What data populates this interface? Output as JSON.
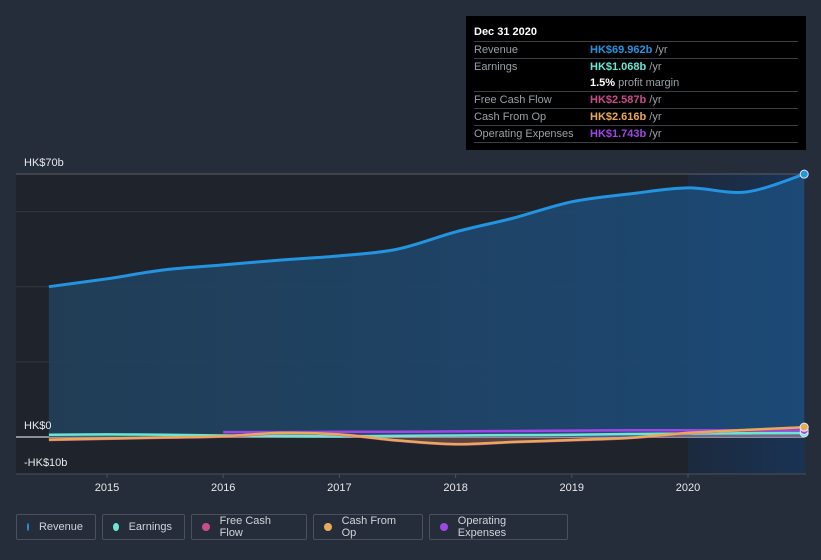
{
  "tooltip": {
    "date": "Dec 31 2020",
    "rows": [
      {
        "label": "Revenue",
        "value": "HK$69.962b",
        "unit": "/yr",
        "color": "#2394df"
      },
      {
        "label": "Earnings",
        "value": "HK$1.068b",
        "unit": "/yr",
        "color": "#6ce5d4"
      },
      {
        "label": "",
        "value": "1.5%",
        "unit": "profit margin",
        "color": "#ffffff"
      },
      {
        "label": "Free Cash Flow",
        "value": "HK$2.587b",
        "unit": "/yr",
        "color": "#c94c8c"
      },
      {
        "label": "Cash From Op",
        "value": "HK$2.616b",
        "unit": "/yr",
        "color": "#e9a95b"
      },
      {
        "label": "Operating Expenses",
        "value": "HK$1.743b",
        "unit": "/yr",
        "color": "#9d48e5"
      }
    ]
  },
  "legend": [
    {
      "label": "Revenue",
      "color": "#2394df"
    },
    {
      "label": "Earnings",
      "color": "#6ce5d4"
    },
    {
      "label": "Free Cash Flow",
      "color": "#c94c8c"
    },
    {
      "label": "Cash From Op",
      "color": "#e9a95b"
    },
    {
      "label": "Operating Expenses",
      "color": "#9d48e5"
    }
  ],
  "chart_data": {
    "type": "area",
    "title": "",
    "xlabel": "",
    "ylabel": "",
    "y_tick_labels": [
      "HK$70b",
      "HK$0",
      "-HK$10b"
    ],
    "y_ticks": [
      70,
      0,
      -10
    ],
    "gridlines": [
      0,
      20,
      40,
      60,
      70
    ],
    "ylim": [
      -10,
      70
    ],
    "xlim": [
      2014.5,
      2021.0
    ],
    "x_ticks": [
      2015,
      2016,
      2017,
      2018,
      2019,
      2020
    ],
    "x_tick_labels": [
      "2015",
      "2016",
      "2017",
      "2018",
      "2019",
      "2020"
    ],
    "highlight_start": 2020.0,
    "unit": "HK$ billions",
    "series": [
      {
        "name": "Revenue",
        "color": "#2394df",
        "x": [
          2014.5,
          2015.0,
          2015.5,
          2016.0,
          2016.5,
          2017.0,
          2017.5,
          2018.0,
          2018.5,
          2019.0,
          2019.5,
          2020.0,
          2020.5,
          2021.0
        ],
        "values": [
          40.0,
          42.1,
          44.5,
          45.8,
          47.1,
          48.2,
          50.0,
          54.6,
          58.3,
          62.6,
          64.7,
          66.3,
          65.2,
          69.96
        ]
      },
      {
        "name": "Earnings",
        "color": "#6ce5d4",
        "x": [
          2014.5,
          2015.0,
          2015.5,
          2016.0,
          2016.5,
          2017.0,
          2017.5,
          2018.0,
          2018.5,
          2019.0,
          2019.5,
          2020.0,
          2020.5,
          2021.0
        ],
        "values": [
          0.6,
          0.7,
          0.6,
          0.4,
          0.3,
          0.2,
          0.3,
          0.4,
          0.5,
          0.6,
          0.8,
          0.9,
          1.0,
          1.07
        ]
      },
      {
        "name": "Free Cash Flow",
        "color": "#c94c8c",
        "x": [
          2014.5,
          2015.0,
          2015.5,
          2016.0,
          2016.5,
          2017.0,
          2017.5,
          2018.0,
          2018.5,
          2019.0,
          2019.5,
          2020.0,
          2020.5,
          2021.0
        ],
        "values": [
          -0.8,
          -0.5,
          -0.2,
          0.1,
          1.0,
          0.6,
          -1.0,
          -2.0,
          -1.4,
          -0.9,
          -0.3,
          1.0,
          1.8,
          2.59
        ]
      },
      {
        "name": "Cash From Op",
        "color": "#e9a95b",
        "x": [
          2014.5,
          2015.0,
          2015.5,
          2016.0,
          2016.5,
          2017.0,
          2017.5,
          2018.0,
          2018.5,
          2019.0,
          2019.5,
          2020.0,
          2020.5,
          2021.0
        ],
        "values": [
          -0.7,
          -0.4,
          -0.1,
          0.2,
          1.1,
          0.7,
          -0.9,
          -1.9,
          -1.3,
          -0.8,
          -0.2,
          1.1,
          1.9,
          2.62
        ]
      },
      {
        "name": "Operating Expenses",
        "color": "#9d48e5",
        "x": [
          2016.0,
          2016.5,
          2017.0,
          2017.5,
          2018.0,
          2018.5,
          2019.0,
          2019.5,
          2020.0,
          2020.5,
          2021.0
        ],
        "values": [
          1.3,
          1.3,
          1.4,
          1.4,
          1.5,
          1.6,
          1.7,
          1.8,
          1.8,
          1.8,
          1.74
        ]
      }
    ]
  }
}
